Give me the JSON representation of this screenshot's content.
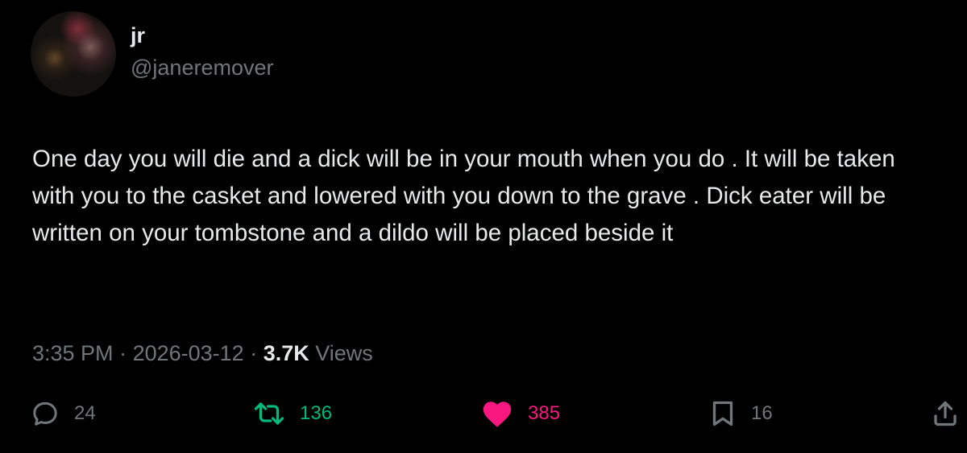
{
  "author": {
    "display_name": "jr",
    "handle": "@janeremover"
  },
  "tweet": {
    "text": "One day you will die and a dick will be in your mouth when you do . It will be taken with you to the casket and lowered with you down to the grave . Dick eater will be written on your tombstone and a dildo will be placed beside it"
  },
  "meta": {
    "time": "3:35 PM",
    "separator": " · ",
    "date": "2026-03-12",
    "views_count": "3.7K",
    "views_label": " Views"
  },
  "actions": {
    "reply": {
      "icon": "reply-icon",
      "count": "24"
    },
    "retweet": {
      "icon": "retweet-icon",
      "count": "136"
    },
    "like": {
      "icon": "heart-icon",
      "count": "385"
    },
    "bookmark": {
      "icon": "bookmark-icon",
      "count": "16"
    },
    "share": {
      "icon": "share-icon"
    }
  },
  "colors": {
    "background": "#000000",
    "text": "#e7e9ea",
    "secondary": "#71767b",
    "retweet": "#00ba7c",
    "like": "#f91880"
  }
}
